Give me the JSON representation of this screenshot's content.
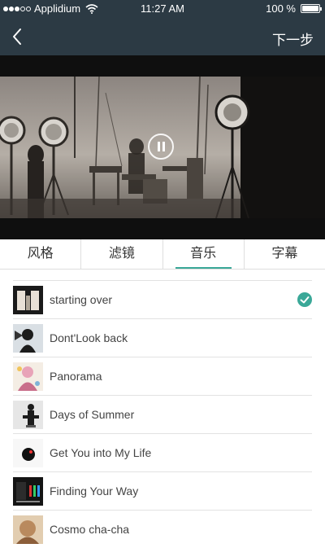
{
  "status_bar": {
    "carrier": "Applidium",
    "time": "11:27 AM",
    "battery": "100 %"
  },
  "nav": {
    "back_icon": "chevron-left-icon",
    "next_label": "下一步"
  },
  "video": {
    "control_icon": "pause-icon"
  },
  "tabs": [
    {
      "label": "风格"
    },
    {
      "label": "滤镜"
    },
    {
      "label": "音乐",
      "active": true
    },
    {
      "label": "字幕"
    }
  ],
  "tracks": [
    {
      "title": "starting over",
      "selected": true
    },
    {
      "title": "Dont'Look back"
    },
    {
      "title": "Panorama"
    },
    {
      "title": "Days of Summer"
    },
    {
      "title": "Get You into My Life"
    },
    {
      "title": "Finding Your Way"
    },
    {
      "title": "Cosmo cha-cha"
    }
  ],
  "colors": {
    "header_bg": "#2c3a44",
    "accent": "#3aa898"
  }
}
